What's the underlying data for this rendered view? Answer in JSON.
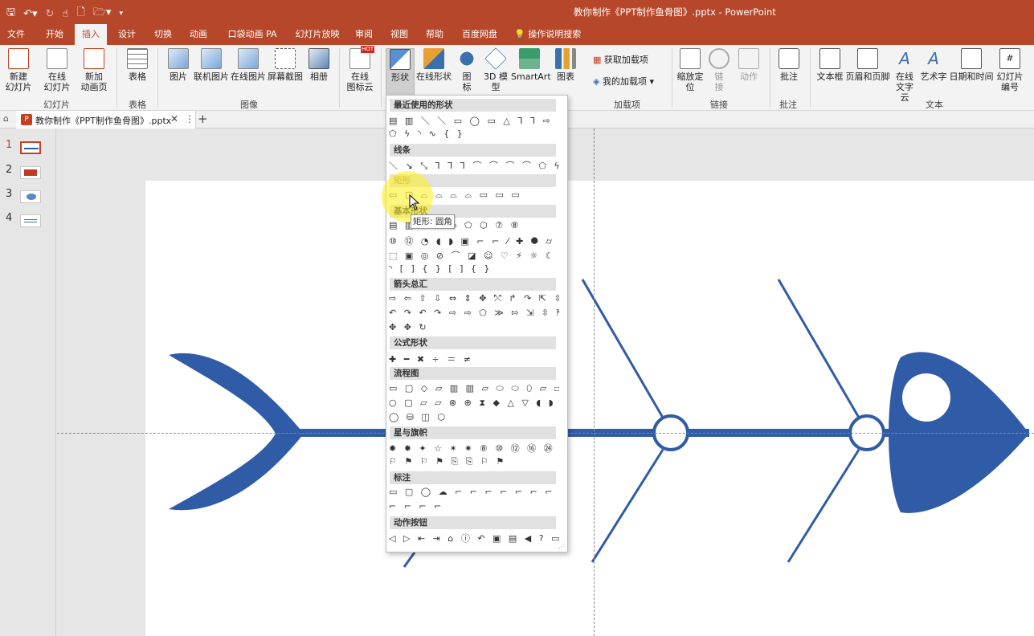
{
  "window": {
    "title": "教你制作《PPT制作鱼骨图》.pptx  -  PowerPoint"
  },
  "qat_icons": [
    "save-icon",
    "undo-icon",
    "redo-icon",
    "touch-mode-icon",
    "new-file-icon",
    "open-file-icon",
    "customize-qat-icon"
  ],
  "tabs": [
    {
      "label": "文件"
    },
    {
      "label": "开始"
    },
    {
      "label": "插入"
    },
    {
      "label": "设计"
    },
    {
      "label": "切换"
    },
    {
      "label": "动画"
    },
    {
      "label": "口袋动画 PA"
    },
    {
      "label": "幻灯片放映"
    },
    {
      "label": "审阅"
    },
    {
      "label": "视图"
    },
    {
      "label": "帮助"
    },
    {
      "label": "百度网盘"
    }
  ],
  "active_tab": "插入",
  "tell_me": "操作说明搜索",
  "ribbon": {
    "new_slide": "新建\n幻灯片",
    "online_slide": "在线\n幻灯片",
    "new_anim_page": "新加\n动画页",
    "table": "表格",
    "picture": "图片",
    "online_picture": "联机图片",
    "online_picture2": "在线图片",
    "screenshot": "屏幕截图",
    "album": "相册",
    "online_icon_cloud": "在线\n图标云",
    "shapes": "形状",
    "online_shapes": "在线形状",
    "icons": "图\n标",
    "model3d": "3D 模\n型",
    "smartart": "SmartArt",
    "chart": "图表",
    "get_addins": "获取加载项",
    "my_addins": "我的加载项",
    "zoom": "缩放定\n位",
    "link": "链\n接",
    "action": "动作",
    "comment": "批注",
    "textbox": "文本框",
    "header_footer": "页眉和页脚",
    "online_text_cloud": "在线\n文字云",
    "wordart": "艺术字",
    "datetime": "日期和时间",
    "slide_number": "幻灯片\n编号",
    "hot_badge": "HOT",
    "groups": {
      "slides": "幻灯片",
      "tables": "表格",
      "images": "图像",
      "addins": "加载项",
      "links": "链接",
      "comments": "批注",
      "text": "文本"
    }
  },
  "doc_tab": {
    "name": "教你制作《PPT制作鱼骨图》.pptx",
    "close": "✕",
    "more": "⋮",
    "add": "+"
  },
  "slides": [
    {
      "number": "1",
      "selected": true
    },
    {
      "number": "2",
      "selected": false
    },
    {
      "number": "3",
      "selected": false
    },
    {
      "number": "4",
      "selected": false
    }
  ],
  "shapes_menu": {
    "categories": {
      "recent": "最近使用的形状",
      "lines": "线条",
      "rects": "矩形",
      "basic": "基本形状",
      "arrows": "箭头总汇",
      "equation": "公式形状",
      "flowchart": "流程图",
      "stars": "星与旗帜",
      "callouts": "标注",
      "actions": "动作按钮"
    },
    "rows": {
      "recent1": "▤ ▥ ＼ ＼ ▭ ◯ ▭ △ ⅂ ⅂ ⇨ ⇩",
      "recent2": "⬠ ϟ ◝ ∿ { }",
      "lines1": "＼ ↘ ⤡ ⅂ ⅂ ⅂ ⌒ ⌒ ⌒ ⌒ ⬠ ϟ",
      "rects1": "▭ ▢ ⌓ ⌓ ⌓ ⌓ ▭ ▭ ▭",
      "basic1": "▤ ▥      ▱ ⏢ ◇ ⬠ ⬡ ⑦ ⑧",
      "basic2": "⑩ ⑫ ◔ ◖ ◗ ▣ ⌐ ⌐ ⁄ ✚ ⯃ ⌭",
      "basic3": "⬚ ▣ ◎ ⊘ ⌒ ◪ ☺ ♡ ⚡ ☼ ☾ ☁",
      "basic4": "◝ [ ] { } [ ] { }",
      "arrows1": "⇨ ⇦ ⇧ ⇩ ⇔ ⇕ ✥ ⤲ ↱ ↷ ⇱ ⇳",
      "arrows2": "↶ ↷ ↶ ↷ ⇨ ⇨ ⬠ ≫ ⇰ ⇲ ⇳ ⇱",
      "arrows3": "✥ ✥ ↻",
      "equation1": "✚ ━ ✖ ÷ ＝ ≠",
      "flow1": "▭ ▢ ◇ ▱ ▥ ▥ ▱ ⬭ ⬭ ⬯ ▱ ⏢",
      "flow2": "○ ▢ ▱ ▱ ⊗ ⊕ ⧗ ◆ △ ▽ ◖ ◗",
      "flow3": "◯ ⛁ ◫ ⬡",
      "stars1": "✹ ✸ ✦ ☆ ✶ ✷ ⑧ ⑩ ⑫ ⑯ ㉔ ㉜",
      "stars2": "⚐ ⚑ ⚐ ⚑ ⎘ ⎘ ⚐ ⚑",
      "callout1": "▭ ▢ ◯ ☁ ⌐ ⌐ ⌐ ⌐ ⌐ ⌐ ⌐ ⌐",
      "callout2": "⌐ ⌐ ⌐ ⌐",
      "action1": "◁ ▷ ⇤ ⇥ ⌂ ⓘ ↶ ▣ ▤ ◀ ? ▭"
    }
  },
  "tooltip": "矩形: 圆角",
  "slide_content": {
    "fish_color": "#2f5ba7",
    "circle_fill": "#ffffff"
  },
  "theme": {
    "accent": "#b7472a",
    "slide_bg": "#ffffff",
    "work_bg": "#e6e6e6"
  }
}
